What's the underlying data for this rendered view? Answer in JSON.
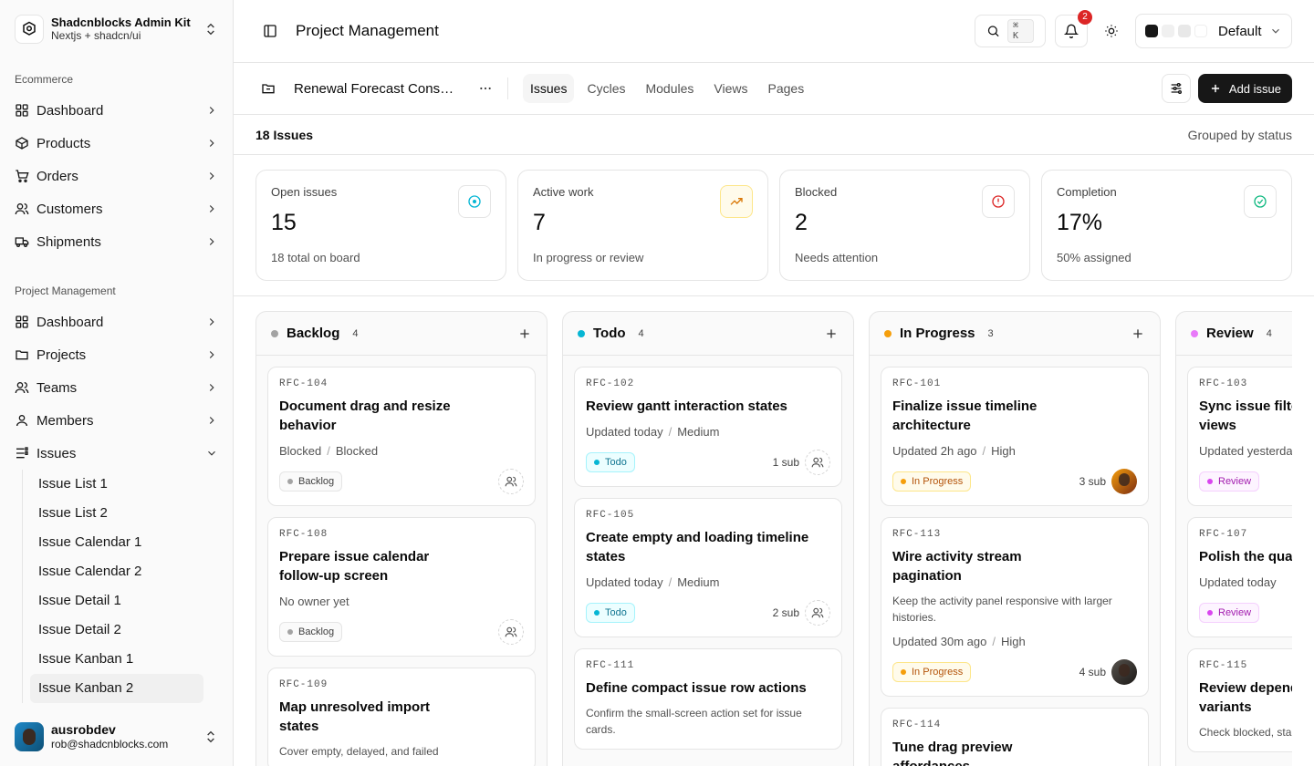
{
  "brand": {
    "title": "Shadcnblocks Admin Kit",
    "subtitle": "Nextjs + shadcn/ui"
  },
  "sidebar": {
    "ecommerce_label": "Ecommerce",
    "ecommerce_items": [
      {
        "label": "Dashboard",
        "icon": "grid-icon"
      },
      {
        "label": "Products",
        "icon": "box-icon"
      },
      {
        "label": "Orders",
        "icon": "cart-icon"
      },
      {
        "label": "Customers",
        "icon": "users-icon"
      },
      {
        "label": "Shipments",
        "icon": "truck-icon"
      }
    ],
    "pm_label": "Project Management",
    "pm_items": [
      {
        "label": "Dashboard",
        "icon": "grid-icon"
      },
      {
        "label": "Projects",
        "icon": "folder-icon"
      },
      {
        "label": "Teams",
        "icon": "users-icon"
      },
      {
        "label": "Members",
        "icon": "user-icon"
      },
      {
        "label": "Issues",
        "icon": "list-icon"
      }
    ],
    "issues_sub": [
      "Issue List 1",
      "Issue List 2",
      "Issue Calendar 1",
      "Issue Calendar 2",
      "Issue Detail 1",
      "Issue Detail 2",
      "Issue Kanban 1",
      "Issue Kanban 2"
    ],
    "active_sub": "Issue Kanban 2"
  },
  "user": {
    "name": "ausrobdev",
    "email": "rob@shadcnblocks.com"
  },
  "header": {
    "title": "Project Management",
    "search_kbd": "⌘ K",
    "notifications": "2",
    "theme": "Default"
  },
  "subbar": {
    "project": "Renewal Forecast Consolidation",
    "tabs": [
      "Issues",
      "Cycles",
      "Modules",
      "Views",
      "Pages"
    ],
    "active_tab": "Issues",
    "add_label": "Add issue"
  },
  "summary": {
    "count": "18 Issues",
    "grouping": "Grouped by status"
  },
  "stats": [
    {
      "label": "Open issues",
      "value": "15",
      "sub": "18 total on board",
      "icon": "target-icon"
    },
    {
      "label": "Active work",
      "value": "7",
      "sub": "In progress or review",
      "icon": "trending-up-icon"
    },
    {
      "label": "Blocked",
      "value": "2",
      "sub": "Needs attention",
      "icon": "alert-circle-icon"
    },
    {
      "label": "Completion",
      "value": "17%",
      "sub": "50% assigned",
      "icon": "check-circle-icon"
    }
  ],
  "colors": {
    "backlog": "#a3a3a3",
    "todo": "#06b6d4",
    "progress": "#f59e0b",
    "review": "#e879f9",
    "target": "#06b6d4",
    "trend": "#d97706",
    "alert": "#dc2626",
    "check": "#10b981"
  },
  "columns": [
    {
      "name": "Backlog",
      "count": "4",
      "color": "#a3a3a3",
      "cards": [
        {
          "code": "RFC-104",
          "title": "Document drag and resize behavior",
          "meta1": "Blocked",
          "meta2": "Blocked",
          "pill": "Backlog",
          "kind": "backlog",
          "subs": "",
          "assignee": "none"
        },
        {
          "code": "RFC-108",
          "title": "Prepare issue calendar follow-up screen",
          "meta1": "No owner yet",
          "meta2": "",
          "pill": "Backlog",
          "kind": "backlog",
          "subs": "",
          "assignee": "none"
        },
        {
          "code": "RFC-109",
          "title": "Map unresolved import states",
          "desc": "Cover empty, delayed, and failed",
          "meta1": "",
          "meta2": "",
          "pill": "",
          "kind": "backlog",
          "subs": "",
          "assignee": "none"
        }
      ]
    },
    {
      "name": "Todo",
      "count": "4",
      "color": "#06b6d4",
      "cards": [
        {
          "code": "RFC-102",
          "title": "Review gantt interaction states",
          "meta1": "Updated today",
          "meta2": "Medium",
          "pill": "Todo",
          "kind": "todo",
          "subs": "1 sub",
          "assignee": "none"
        },
        {
          "code": "RFC-105",
          "title": "Create empty and loading timeline states",
          "meta1": "Updated today",
          "meta2": "Medium",
          "pill": "Todo",
          "kind": "todo",
          "subs": "2 sub",
          "assignee": "none"
        },
        {
          "code": "RFC-111",
          "title": "Define compact issue row actions",
          "desc": "Confirm the small-screen action set for issue cards.",
          "meta1": "",
          "meta2": "",
          "pill": "",
          "kind": "todo",
          "subs": "",
          "assignee": "none"
        }
      ]
    },
    {
      "name": "In Progress",
      "count": "3",
      "color": "#f59e0b",
      "cards": [
        {
          "code": "RFC-101",
          "title": "Finalize issue timeline architecture",
          "meta1": "Updated 2h ago",
          "meta2": "High",
          "pill": "In Progress",
          "kind": "prog",
          "subs": "3 sub",
          "assignee": "face1"
        },
        {
          "code": "RFC-113",
          "title": "Wire activity stream pagination",
          "desc": "Keep the activity panel responsive with larger histories.",
          "meta1": "Updated 30m ago",
          "meta2": "High",
          "pill": "In Progress",
          "kind": "prog",
          "subs": "4 sub",
          "assignee": "face2"
        },
        {
          "code": "RFC-114",
          "title": "Tune drag preview affordances",
          "meta1": "",
          "meta2": "",
          "pill": "",
          "kind": "prog",
          "subs": "",
          "assignee": "none"
        }
      ]
    },
    {
      "name": "Review",
      "count": "4",
      "color": "#e879f9",
      "cards": [
        {
          "code": "RFC-103",
          "title": "Sync issue filters across views",
          "meta1": "Updated yesterday",
          "meta2": "",
          "pill": "Review",
          "kind": "rev",
          "subs": "",
          "assignee": "none"
        },
        {
          "code": "RFC-107",
          "title": "Polish the quarterly view",
          "meta1": "Updated today",
          "meta2": "",
          "pill": "Review",
          "kind": "rev",
          "subs": "",
          "assignee": "none"
        },
        {
          "code": "RFC-115",
          "title": "Review dependency variants",
          "desc": "Check blocked, stale",
          "meta1": "",
          "meta2": "",
          "pill": "",
          "kind": "rev",
          "subs": "",
          "assignee": "none"
        }
      ]
    }
  ]
}
